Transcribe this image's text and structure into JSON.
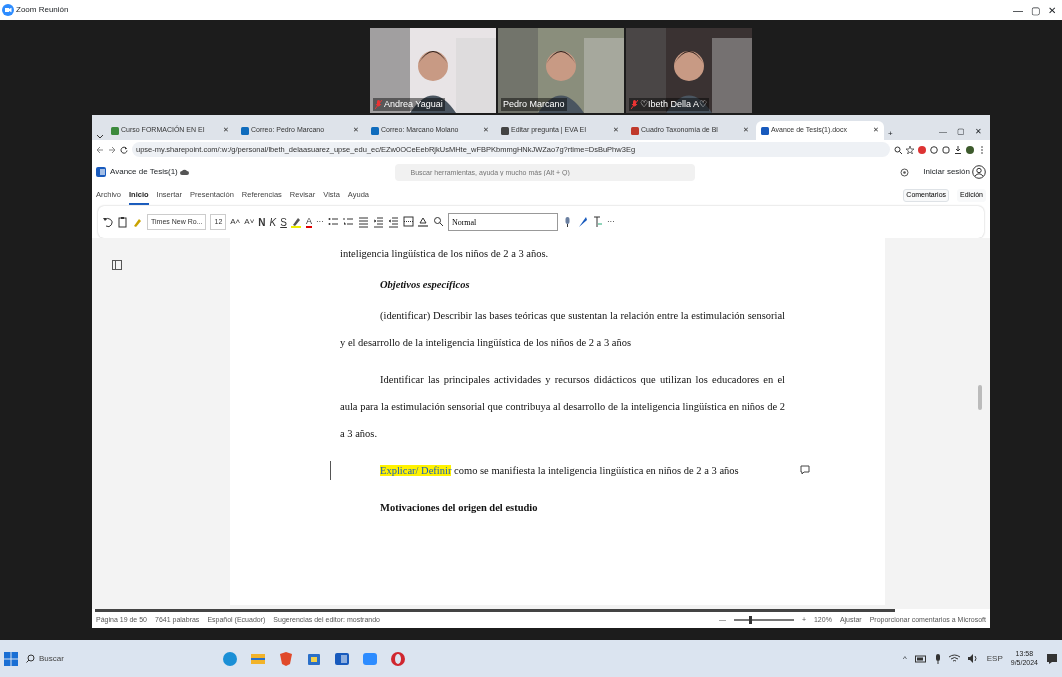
{
  "window": {
    "title": "Zoom Reunión",
    "controls": [
      "—",
      "▢",
      "✕"
    ]
  },
  "participants": [
    {
      "name": "Andrea Yaguai",
      "muted": true
    },
    {
      "name": "Pedro Marcano",
      "muted": false
    },
    {
      "name": "♡Ibeth Della A♡",
      "muted": true
    }
  ],
  "browser": {
    "tabs": [
      {
        "label": "Curso FORMACIÓN EN EI",
        "close": "✕",
        "selected": false,
        "color": "#3c8a3c"
      },
      {
        "label": "Correo: Pedro Marcano",
        "close": "✕",
        "selected": false,
        "color": "#0f6cbd"
      },
      {
        "label": "Correo: Marcano Molano",
        "close": "✕",
        "selected": false,
        "color": "#0f6cbd"
      },
      {
        "label": "Editar pregunta | EVA EI",
        "close": "✕",
        "selected": false,
        "color": "#444444"
      },
      {
        "label": "Cuadro Taxonomía de Bl",
        "close": "✕",
        "selected": false,
        "color": "#c0392b"
      },
      {
        "label": "Avance de Tesis(1).docx",
        "close": "✕",
        "selected": true,
        "color": "#185abd"
      }
    ],
    "new_tab": "+",
    "controls": [
      "—",
      "▢",
      "✕"
    ],
    "address": "upse-my.sharepoint.com/:w:/g/personal/lbeth_delaasuarez_upse_edu_ec/EZw0OCeEebRjkUsMHte_wFBPKbmmgHNkJWZao7g?rtime=DsBuPhw3Eg"
  },
  "word": {
    "doc_title": "Avance de Tesis(1)",
    "search_placeholder": "Buscar herramientas, ayuda y mucho más (Alt + Q)",
    "sign_in": "Iniciar sesión",
    "ribbon_tabs": [
      {
        "label": "Archivo",
        "selected": false
      },
      {
        "label": "Inicio",
        "selected": true
      },
      {
        "label": "Insertar",
        "selected": false
      },
      {
        "label": "Presentación",
        "selected": false
      },
      {
        "label": "Referencias",
        "selected": false
      },
      {
        "label": "Revisar",
        "selected": false
      },
      {
        "label": "Vista",
        "selected": false
      },
      {
        "label": "Ayuda",
        "selected": false
      }
    ],
    "comments_button": "Comentarios",
    "edit_button": "Edición",
    "toolbar": [
      {
        "kind": "icon"
      },
      {
        "kind": "icon"
      },
      {
        "kind": "icon"
      },
      {
        "kind": "select",
        "text": "Times New Ro..."
      },
      {
        "kind": "select",
        "text": "12"
      },
      {
        "kind": "text",
        "text": "A˄"
      },
      {
        "kind": "text",
        "text": "A˅"
      },
      {
        "kind": "bold",
        "text": "N"
      },
      {
        "kind": "italic",
        "text": "K"
      },
      {
        "kind": "underline",
        "text": "S"
      },
      {
        "kind": "icon"
      },
      {
        "kind": "fontcolor",
        "text": "A"
      },
      {
        "kind": "text",
        "text": "···"
      },
      {
        "kind": "icon"
      },
      {
        "kind": "icon"
      },
      {
        "kind": "icon"
      },
      {
        "kind": "icon"
      },
      {
        "kind": "icon"
      },
      {
        "kind": "icon"
      },
      {
        "kind": "icon"
      },
      {
        "kind": "icon"
      },
      {
        "kind": "style",
        "text": "Normal"
      },
      {
        "kind": "icon"
      },
      {
        "kind": "icon"
      },
      {
        "kind": "icon"
      },
      {
        "kind": "icon"
      },
      {
        "kind": "text",
        "text": "···"
      }
    ],
    "paragraphs": [
      {
        "kind": "body",
        "indent": false,
        "segments": [
          {
            "text": "inteligencia lingüística de los niños de 2 a 3 años.",
            "highlighted": false
          }
        ]
      },
      {
        "kind": "subheading",
        "indent": true,
        "segments": [
          {
            "text": "Objetivos específicos",
            "highlighted": false
          }
        ]
      },
      {
        "kind": "body",
        "indent": true,
        "segments": [
          {
            "text": "(identificar) Describir las bases teóricas que sustentan la relación entre la estimulación sensorial y el desarrollo de la inteligencia lingüística de los niños de 2 a 3 años",
            "highlighted": false
          }
        ]
      },
      {
        "kind": "body",
        "indent": true,
        "segments": [
          {
            "text": "Identificar las principales actividades y recursos didácticos que utilizan los educadores en el aula para la estimulación sensorial que contribuya al desarrollo de la inteligencia lingüística en niños de 2 a 3 años.",
            "highlighted": false
          }
        ]
      },
      {
        "kind": "body",
        "indent": true,
        "changed": true,
        "comment": true,
        "segments": [
          {
            "text": "Explicar/ Definir",
            "highlighted": true
          },
          {
            "text": " como se manifiesta la inteligencia lingüística en niños de 2 a 3 años",
            "highlighted": false
          }
        ]
      },
      {
        "kind": "heading",
        "indent": true,
        "segments": [
          {
            "text": "Motivaciones del origen del estudio",
            "highlighted": false
          }
        ]
      }
    ],
    "status": [
      "Página 19 de 50",
      "7641 palabras",
      "Español (Ecuador)",
      "Sugerencias del editor: mostrando"
    ],
    "zoom": {
      "minus": "—",
      "plus": "+",
      "level": 0.3,
      "reading": "120%",
      "fit": "Ajustar",
      "feedback": "Proporcionar comentarios a Microsoft"
    }
  },
  "taskbar": {
    "search": "Buscar",
    "apps": [
      {
        "color": "#1b8fd6"
      },
      {
        "color": "#f2b32a"
      },
      {
        "color": "#e0492a"
      },
      {
        "color": "#2a6fc9"
      },
      {
        "color": "#185abd"
      },
      {
        "color": "#2d8cff"
      },
      {
        "color": "#d0262f"
      }
    ],
    "tray": [
      "^",
      "ESP"
    ],
    "time": "13:58",
    "date": "9/5/2024"
  }
}
